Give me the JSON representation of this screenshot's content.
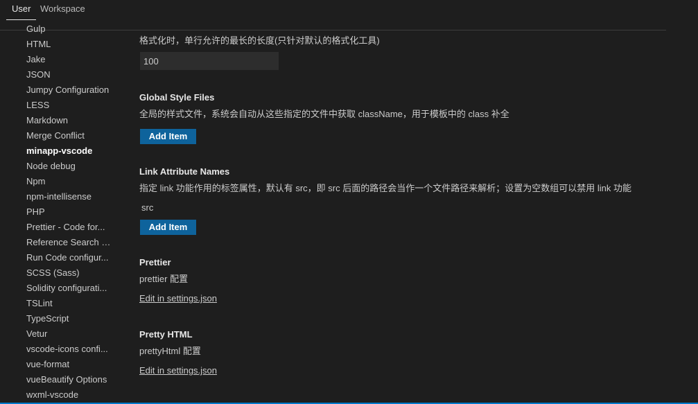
{
  "tabs": [
    {
      "label": "User"
    },
    {
      "label": "Workspace"
    }
  ],
  "toc": [
    "Gulp",
    "HTML",
    "Jake",
    "JSON",
    "Jumpy Configuration",
    "LESS",
    "Markdown",
    "Merge Conflict",
    "minapp-vscode",
    "Node debug",
    "Npm",
    "npm-intellisense",
    "PHP",
    "Prettier - Code for...",
    "Reference Search V...",
    "Run Code configur...",
    "SCSS (Sass)",
    "Solidity configurati...",
    "TSLint",
    "TypeScript",
    "Vetur",
    "vscode-icons confi...",
    "vue-format",
    "vueBeautify Options",
    "wxml-vscode"
  ],
  "settings": {
    "format_width": {
      "desc": "格式化时，单行允许的最长的长度(只针对默认的格式化工具)",
      "value": "100"
    },
    "global_style": {
      "title": "Global Style Files",
      "desc": "全局的样式文件，系统会自动从这些指定的文件中获取 className，用于模板中的 class 补全",
      "button": "Add Item"
    },
    "link_attr": {
      "title": "Link Attribute Names",
      "desc": "指定 link 功能作用的标签属性，默认有 src，即 src 后面的路径会当作一个文件路径来解析；设置为空数组可以禁用 link 功能",
      "item": "src",
      "button": "Add Item"
    },
    "prettier": {
      "title": "Prettier",
      "desc": "prettier 配置",
      "link": "Edit in settings.json"
    },
    "pretty_html": {
      "title": "Pretty HTML",
      "desc": "prettyHtml 配置",
      "link": "Edit in settings.json"
    }
  }
}
